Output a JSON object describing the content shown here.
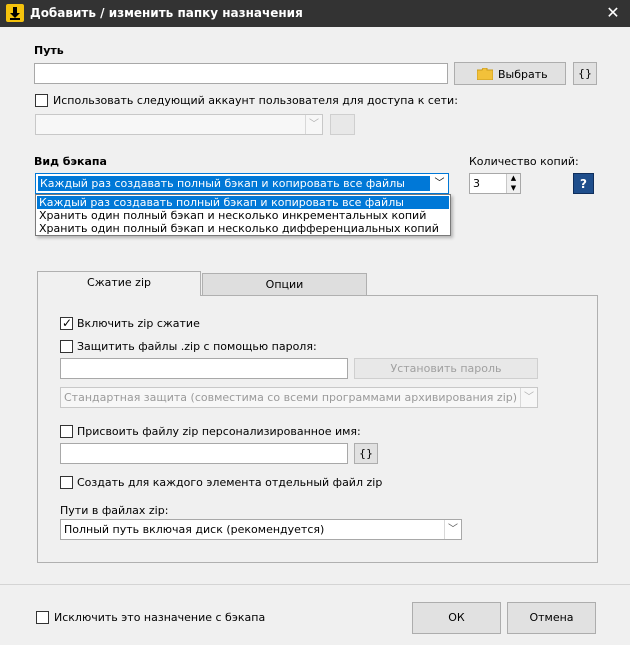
{
  "window": {
    "title": "Добавить / изменить папку назначения",
    "close_glyph": "✕",
    "icon": "app-download-icon"
  },
  "path_section": {
    "label": "Путь",
    "value": "",
    "browse_label": "Выбрать",
    "vars_label": "{}"
  },
  "network_account": {
    "checkbox_label": "Использовать следующий аккаунт пользователя для доступа к сети:",
    "checked": false,
    "account_value": ""
  },
  "backup_type": {
    "label": "Вид бэкапа",
    "selected": "Каждый раз создавать полный бэкап и копировать все файлы",
    "options": [
      "Каждый раз создавать полный бэкап и копировать все файлы",
      "Хранить один полный бэкап и несколько инкрементальных копий",
      "Хранить один полный бэкап и несколько дифференциальных копий"
    ]
  },
  "copies": {
    "label": "Количество копий:",
    "value": "3",
    "help_label": "?"
  },
  "tabs": [
    {
      "label": "Сжатие zip",
      "active": true
    },
    {
      "label": "Опции",
      "active": false
    }
  ],
  "zip": {
    "enable_label": "Включить zip сжатие",
    "enable_checked": true,
    "protect_label": "Защитить файлы .zip с помощью пароля:",
    "protect_checked": false,
    "password_value": "",
    "set_password_label": "Установить пароль",
    "encryption_selected": "Стандартная защита (совместима со всеми программами архивирования zip)",
    "custom_name_label": "Присвоить файлу zip персонализированное имя:",
    "custom_name_checked": false,
    "custom_name_value": "",
    "vars_label": "{}",
    "separate_label": "Создать для каждого элемента отдельный файл zip",
    "separate_checked": false,
    "paths_label": "Пути в файлах zip:",
    "paths_selected": "Полный путь включая диск (рекомендуется)"
  },
  "footer": {
    "exclude_label": "Исключить это назначение с бэкапа",
    "exclude_checked": false,
    "ok_label": "ОК",
    "cancel_label": "Отмена"
  },
  "colors": {
    "titlebar": "#333333",
    "accent_selection": "#0078d7",
    "help_button": "#1f4e8c",
    "folder_icon": "#f2c13a"
  }
}
